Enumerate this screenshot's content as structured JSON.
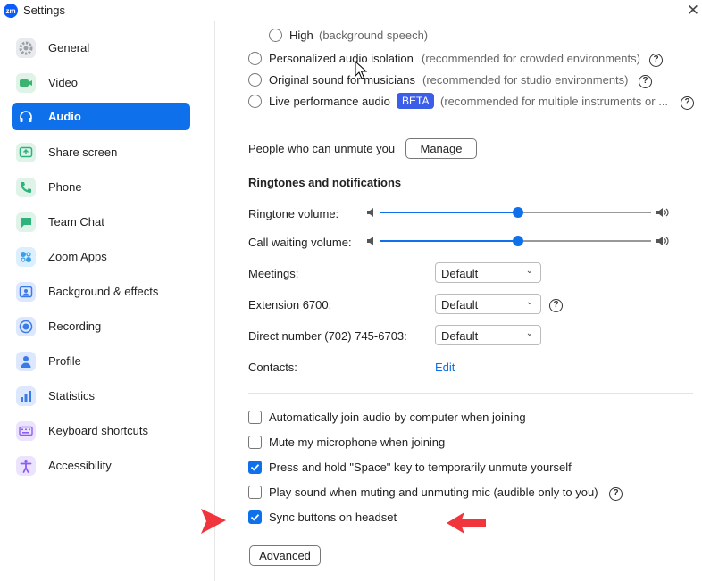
{
  "window": {
    "title": "Settings",
    "logo_text": "zm"
  },
  "sidebar": {
    "items": [
      {
        "label": "General",
        "icon": "gear-icon",
        "color": "#9aa0a6"
      },
      {
        "label": "Video",
        "icon": "video-camera-icon",
        "color": "#3cb371"
      },
      {
        "label": "Audio",
        "icon": "headphones-icon",
        "color": "#ffffff",
        "active": true
      },
      {
        "label": "Share screen",
        "icon": "share-screen-icon",
        "color": "#2fb37c"
      },
      {
        "label": "Phone",
        "icon": "phone-icon",
        "color": "#2fb37c"
      },
      {
        "label": "Team Chat",
        "icon": "chat-icon",
        "color": "#2fb37c"
      },
      {
        "label": "Zoom Apps",
        "icon": "apps-icon",
        "color": "#3aa0e6"
      },
      {
        "label": "Background & effects",
        "icon": "background-icon",
        "color": "#3a7be6"
      },
      {
        "label": "Recording",
        "icon": "record-icon",
        "color": "#3a7be6"
      },
      {
        "label": "Profile",
        "icon": "profile-icon",
        "color": "#3a7be6"
      },
      {
        "label": "Statistics",
        "icon": "statistics-icon",
        "color": "#3a7be6"
      },
      {
        "label": "Keyboard shortcuts",
        "icon": "keyboard-icon",
        "color": "#8b5cf6"
      },
      {
        "label": "Accessibility",
        "icon": "accessibility-icon",
        "color": "#8b5cf6"
      }
    ]
  },
  "audio": {
    "high_label": "High",
    "high_note": "(background speech)",
    "personalized_label": "Personalized audio isolation",
    "personalized_note": "(recommended for crowded environments)",
    "original_label": "Original sound for musicians",
    "original_note": "(recommended for studio environments)",
    "live_label": "Live performance audio",
    "beta_badge": "BETA",
    "live_note": "(recommended for multiple instruments or ...",
    "unmute_label": "People who can unmute you",
    "manage_button": "Manage",
    "ringtones_title": "Ringtones and notifications",
    "ringtone_volume_label": "Ringtone volume:",
    "ringtone_volume_level": 0.51,
    "call_waiting_label": "Call waiting volume:",
    "call_waiting_level": 0.51,
    "meetings_label": "Meetings:",
    "meetings_value": "Default",
    "extension_label": "Extension 6700:",
    "extension_value": "Default",
    "direct_label": "Direct number (702) 745-6703:",
    "direct_value": "Default",
    "contacts_label": "Contacts:",
    "contacts_link": "Edit",
    "options": [
      {
        "label": "Automatically join audio by computer when joining",
        "checked": false
      },
      {
        "label": "Mute my microphone when joining",
        "checked": false
      },
      {
        "label": "Press and hold \"Space\" key to temporarily unmute yourself",
        "checked": true
      },
      {
        "label": "Play sound when muting and unmuting mic (audible only to you)",
        "checked": false,
        "help": true
      },
      {
        "label": "Sync buttons on headset",
        "checked": true
      }
    ],
    "advanced_button": "Advanced",
    "accent_color": "#0e71eb",
    "annotation_color": "#f0353d"
  }
}
